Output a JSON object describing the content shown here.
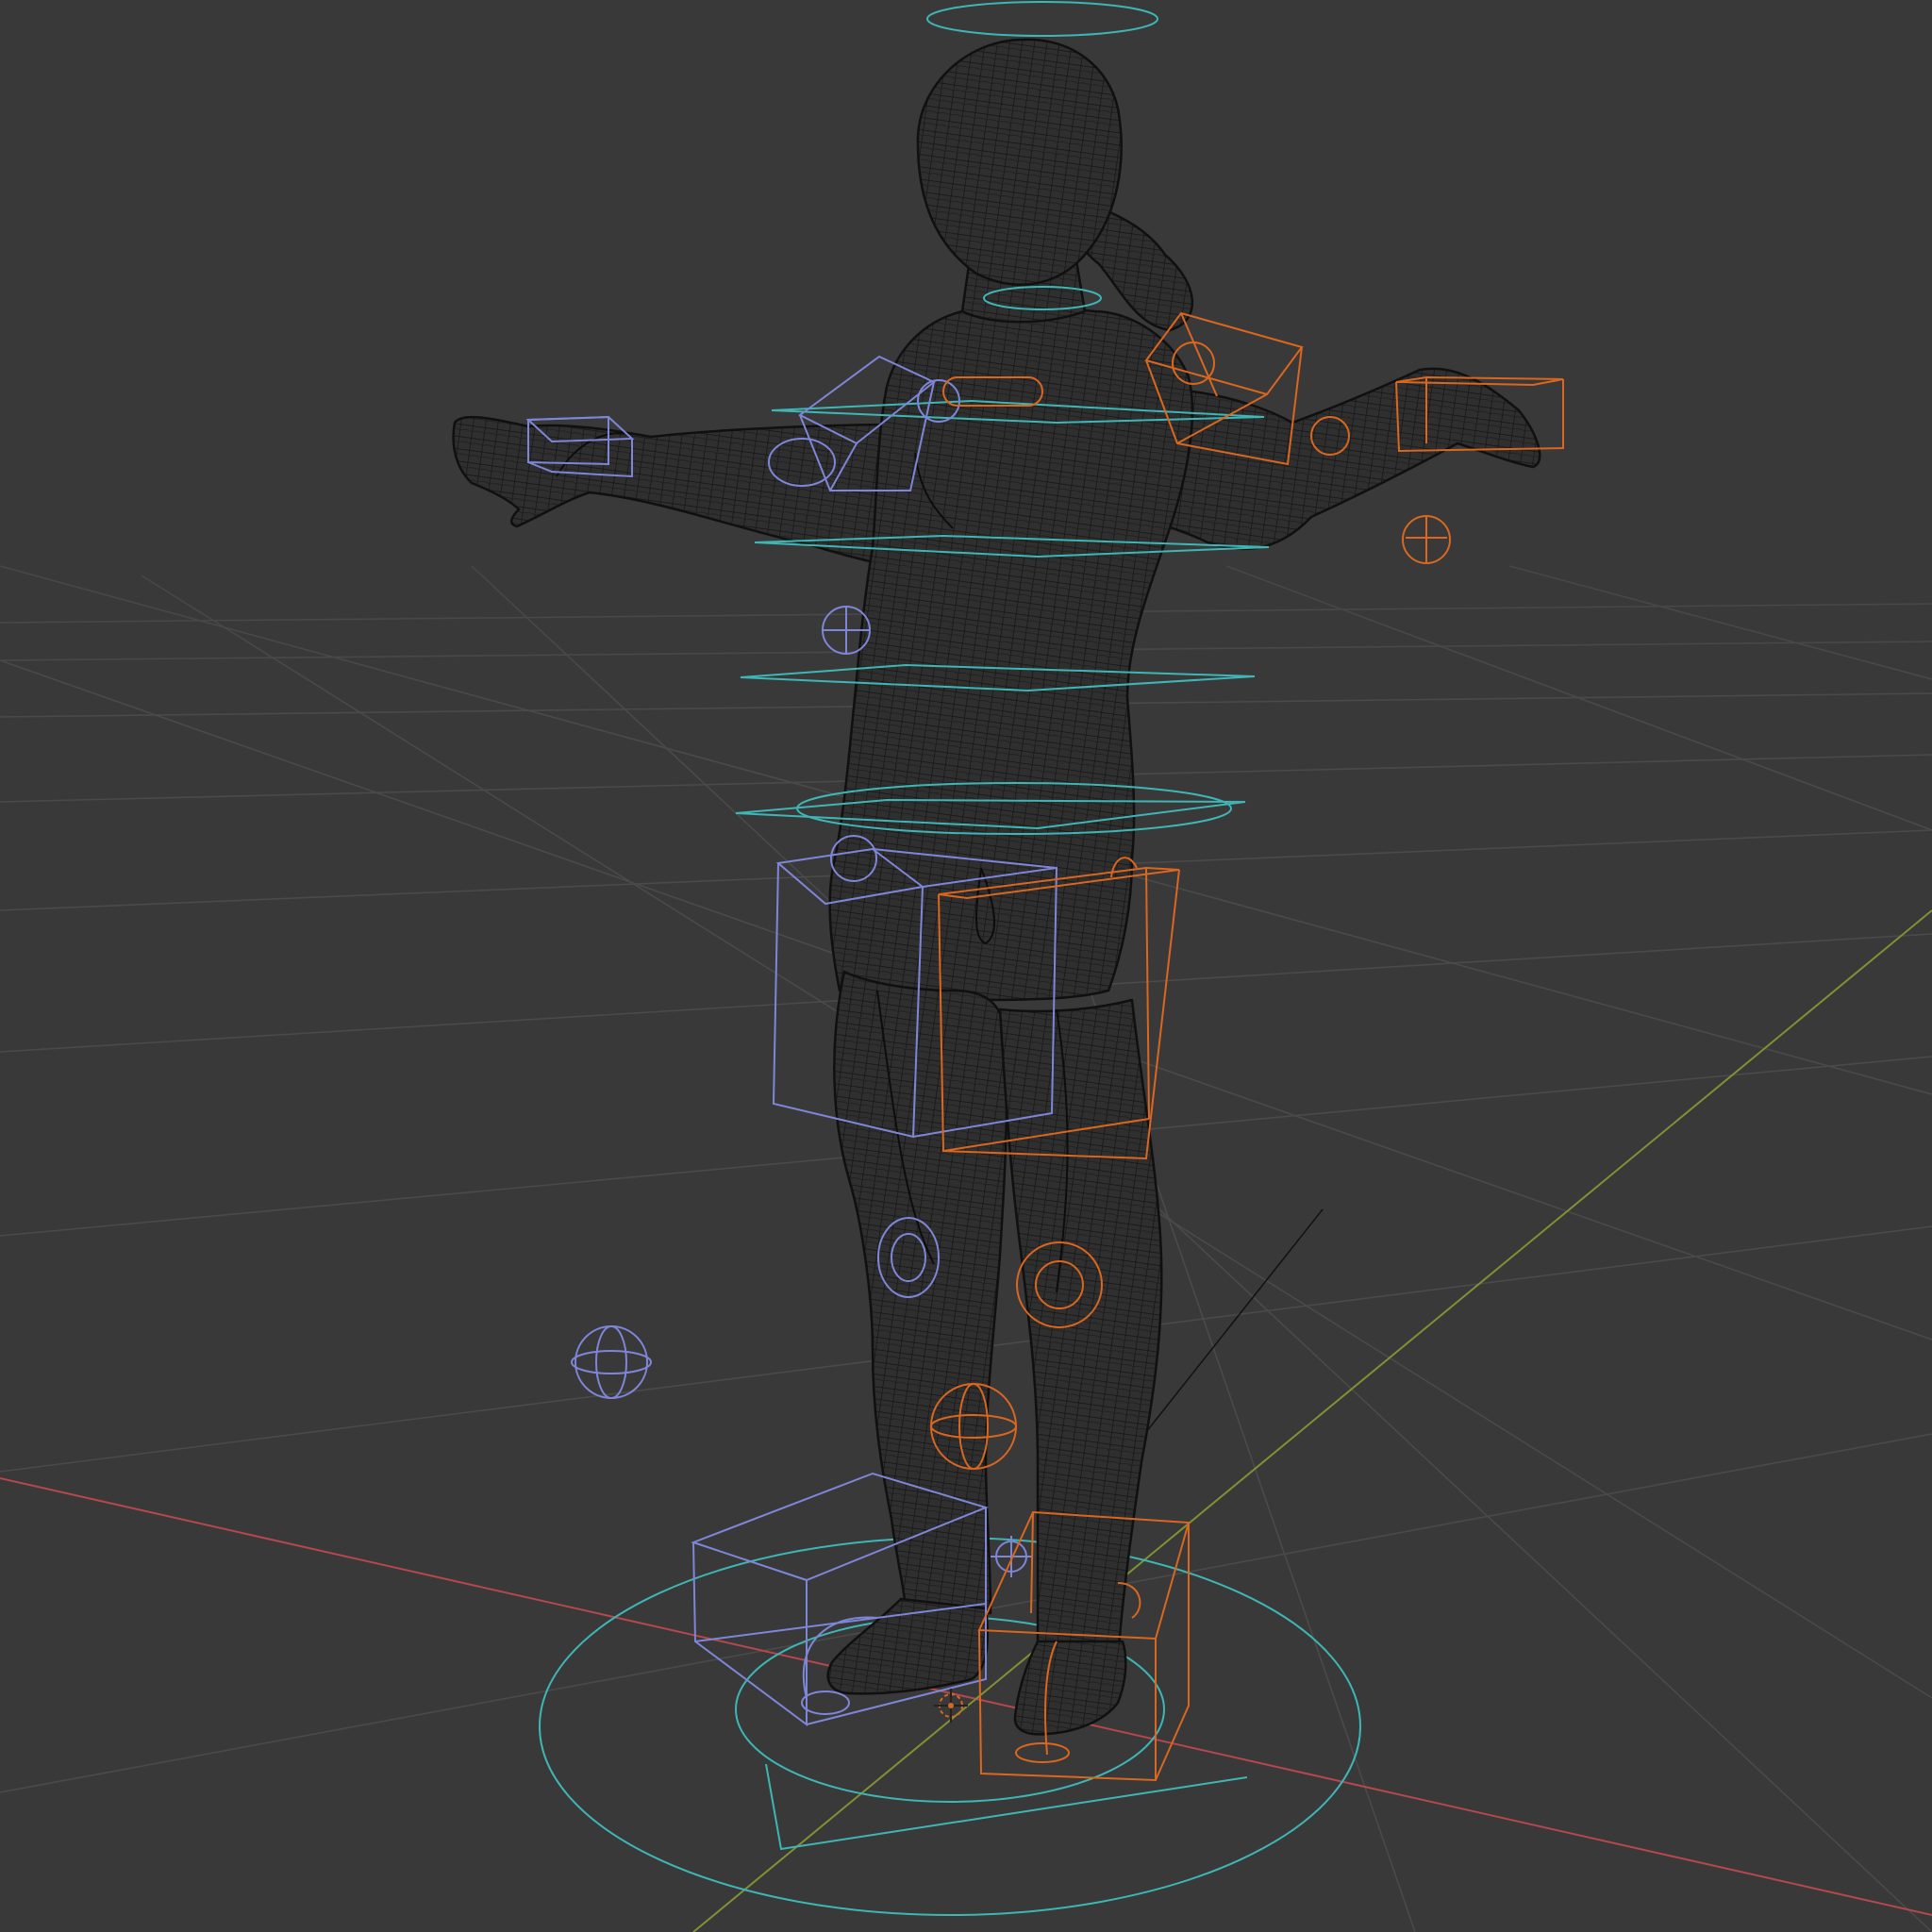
{
  "viewport": {
    "shading_mode": "wireframe",
    "background_color": "#393939",
    "grid_color": "#4a4a4a",
    "x_axis_color": "#b5474e",
    "y_axis_color": "#7f9133",
    "mesh_wire_color": "#151515",
    "mesh_fill_color": "#2f2f2f",
    "rig_colors": {
      "center_controls": "#3fb6b6",
      "left_side_controls": "#7e86d8",
      "right_side_controls": "#d9671f"
    },
    "objects": [
      {
        "name": "character-mesh",
        "kind": "wireframe-mesh"
      },
      {
        "name": "rig-root-circle",
        "kind": "control-circle",
        "group": "center"
      },
      {
        "name": "torso-hoops",
        "kind": "control-circle",
        "group": "center"
      },
      {
        "name": "left-arm-ik-box",
        "kind": "control-box",
        "group": "left"
      },
      {
        "name": "right-arm-ik-box",
        "kind": "control-box",
        "group": "right"
      },
      {
        "name": "left-thigh-box",
        "kind": "control-box",
        "group": "left"
      },
      {
        "name": "right-thigh-box",
        "kind": "control-box",
        "group": "right"
      },
      {
        "name": "left-foot-box",
        "kind": "control-box",
        "group": "left"
      },
      {
        "name": "right-foot-box",
        "kind": "control-box",
        "group": "right"
      },
      {
        "name": "pole-targets",
        "kind": "control-sphere"
      },
      {
        "name": "3d-cursor",
        "kind": "cursor"
      }
    ]
  }
}
